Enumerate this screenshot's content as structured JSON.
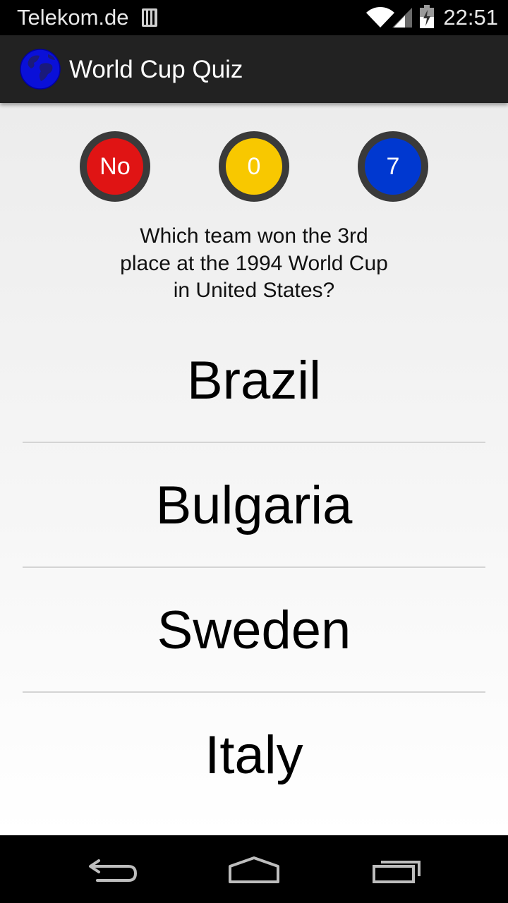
{
  "status_bar": {
    "carrier": "Telekom.de",
    "time": "22:51",
    "icons": [
      "sim-icon",
      "wifi-icon",
      "signal-icon",
      "battery-icon"
    ]
  },
  "action_bar": {
    "title": "World Cup Quiz",
    "icon": "globe-icon"
  },
  "quiz": {
    "status_badge": {
      "label": "No",
      "color": "#e01414"
    },
    "score_badge": {
      "label": "0",
      "color": "#f8c800"
    },
    "count_badge": {
      "label": "7",
      "color": "#0038d0"
    },
    "question": "Which team won the 3rd place at the 1994 World Cup in United States?",
    "answers": [
      "Brazil",
      "Bulgaria",
      "Sweden",
      "Italy"
    ]
  },
  "nav_bar": {
    "icons": [
      "back-icon",
      "home-icon",
      "recents-icon"
    ]
  },
  "colors": {
    "status_bar_bg": "#000000",
    "action_bar_bg": "#222222",
    "badge_ring": "#3a3a3a",
    "divider": "#d4d4d4"
  }
}
